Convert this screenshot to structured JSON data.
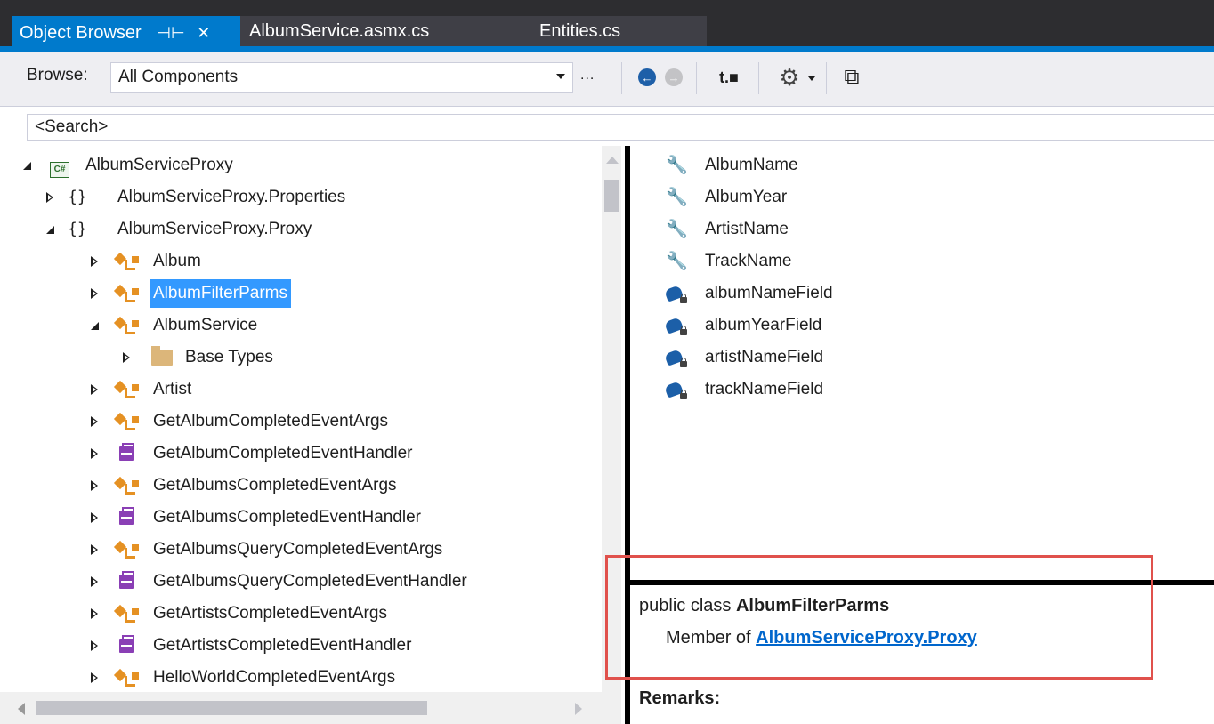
{
  "tabs": [
    {
      "label": "Object Browser",
      "active": true,
      "pin": "⊣⊢",
      "close": "✕"
    },
    {
      "label": "AlbumService.asmx.cs",
      "active": false
    },
    {
      "label": "Entities.cs",
      "active": false
    }
  ],
  "toolbar": {
    "browse_label": "Browse:",
    "browse_value": "All Components",
    "ellipsis": "...",
    "buttons": [
      {
        "icon": "navigate-back-icon",
        "glyph": "←"
      },
      {
        "icon": "navigate-forward-icon",
        "glyph": "→"
      },
      {
        "icon": "add-reference-icon",
        "glyph": "t.■"
      },
      {
        "icon": "settings-gear-icon",
        "glyph": "⚙"
      },
      {
        "icon": "view-hierarchy-icon",
        "glyph": "⧉"
      }
    ]
  },
  "search": {
    "placeholder": "<Search>"
  },
  "tree": {
    "items": [
      {
        "label": "AlbumServiceProxy",
        "icon": "csharp-project-icon",
        "expanded": true
      },
      {
        "label": "AlbumServiceProxy.Properties",
        "icon": "namespace-icon",
        "expanded": false
      },
      {
        "label": "AlbumServiceProxy.Proxy",
        "icon": "namespace-icon",
        "expanded": true
      },
      {
        "label": "Album",
        "icon": "class-icon"
      },
      {
        "label": "AlbumFilterParms",
        "icon": "class-icon",
        "selected": true
      },
      {
        "label": "AlbumService",
        "icon": "class-icon",
        "expanded": true
      },
      {
        "label": "Base Types",
        "icon": "folder-icon"
      },
      {
        "label": "Artist",
        "icon": "class-icon"
      },
      {
        "label": "GetAlbumCompletedEventArgs",
        "icon": "class-icon"
      },
      {
        "label": "GetAlbumCompletedEventHandler",
        "icon": "delegate-icon"
      },
      {
        "label": "GetAlbumsCompletedEventArgs",
        "icon": "class-icon"
      },
      {
        "label": "GetAlbumsCompletedEventHandler",
        "icon": "delegate-icon"
      },
      {
        "label": "GetAlbumsQueryCompletedEventArgs",
        "icon": "class-icon"
      },
      {
        "label": "GetAlbumsQueryCompletedEventHandler",
        "icon": "delegate-icon"
      },
      {
        "label": "GetArtistsCompletedEventArgs",
        "icon": "class-icon"
      },
      {
        "label": "GetArtistsCompletedEventHandler",
        "icon": "delegate-icon"
      },
      {
        "label": "HelloWorldCompletedEventArgs",
        "icon": "class-icon"
      }
    ]
  },
  "members": {
    "items": [
      {
        "label": "AlbumName",
        "icon": "property-wrench-icon"
      },
      {
        "label": "AlbumYear",
        "icon": "property-wrench-icon"
      },
      {
        "label": "ArtistName",
        "icon": "property-wrench-icon"
      },
      {
        "label": "TrackName",
        "icon": "property-wrench-icon"
      },
      {
        "label": "albumNameField",
        "icon": "private-field-icon"
      },
      {
        "label": "albumYearField",
        "icon": "private-field-icon"
      },
      {
        "label": "artistNameField",
        "icon": "private-field-icon"
      },
      {
        "label": "trackNameField",
        "icon": "private-field-icon"
      }
    ]
  },
  "description": {
    "prefix": "public class ",
    "class_name": "AlbumFilterParms",
    "member_of": "Member of ",
    "namespace_link": "AlbumServiceProxy.Proxy",
    "remarks": "Remarks:"
  },
  "colors": {
    "accent": "#007acc",
    "selection": "#3399ff",
    "highlight_box": "#e0514c",
    "link": "#0066cc"
  }
}
